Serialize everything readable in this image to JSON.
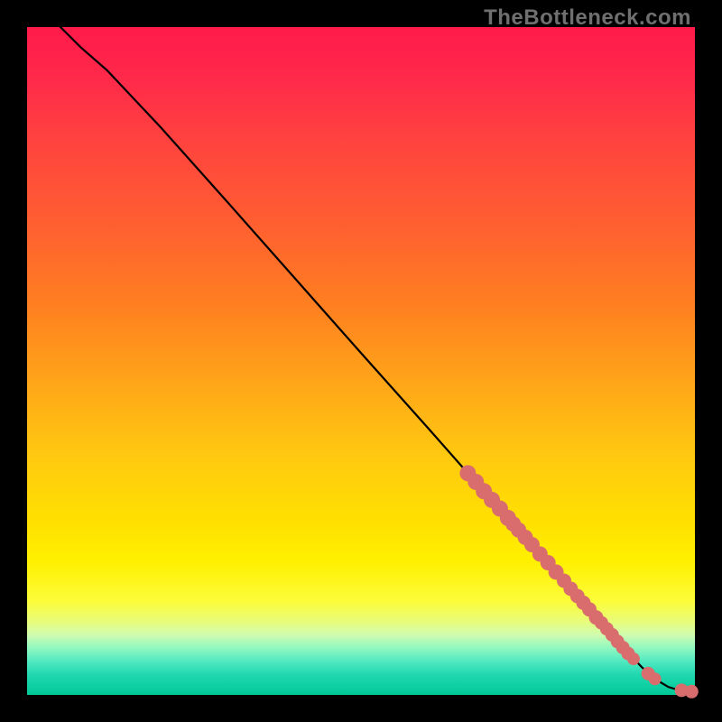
{
  "watermark": "TheBottleneck.com",
  "chart_data": {
    "type": "line",
    "title": "",
    "xlabel": "",
    "ylabel": "",
    "xlim": [
      0,
      100
    ],
    "ylim": [
      0,
      100
    ],
    "curve": {
      "x": [
        5,
        8,
        12,
        20,
        30,
        40,
        50,
        60,
        66,
        70,
        75,
        80,
        84,
        88,
        90.5,
        92,
        94,
        96,
        98,
        100
      ],
      "y": [
        100,
        97,
        93.5,
        85,
        73.8,
        62.5,
        51.2,
        40,
        33.2,
        28.7,
        23,
        17.4,
        12.9,
        8.4,
        5.8,
        4.2,
        2.4,
        1.2,
        0.6,
        0.5
      ]
    },
    "points_cluster": {
      "description": "salmon dot markers clustered near the lower-right tail of the curve",
      "x": [
        66,
        67.2,
        68.4,
        69.6,
        70.8,
        72.0,
        72.8,
        73.6,
        74.6,
        75.6,
        76.8,
        78.0,
        79.2,
        80.4,
        81.4,
        82.4,
        83.3,
        84.2,
        85.2,
        86.0,
        86.8,
        87.6,
        88.4,
        89.2,
        90.0,
        90.8,
        93.0,
        94.0,
        98.0,
        99.5
      ],
      "y": [
        33.2,
        31.9,
        30.5,
        29.2,
        27.9,
        26.5,
        25.6,
        24.7,
        23.6,
        22.5,
        21.1,
        19.8,
        18.4,
        17.1,
        15.9,
        14.8,
        13.8,
        12.8,
        11.6,
        10.8,
        9.9,
        9.0,
        8.0,
        7.1,
        6.2,
        5.4,
        3.2,
        2.4,
        0.7,
        0.5
      ],
      "r": [
        9,
        9,
        9,
        9,
        9,
        9,
        8.5,
        8.5,
        8.5,
        8.5,
        8.5,
        8.5,
        8.5,
        8,
        8,
        8,
        8,
        8,
        8,
        7.5,
        7.5,
        7.5,
        7.5,
        7.5,
        7.5,
        7,
        7.5,
        7,
        7.5,
        7.5
      ]
    }
  }
}
